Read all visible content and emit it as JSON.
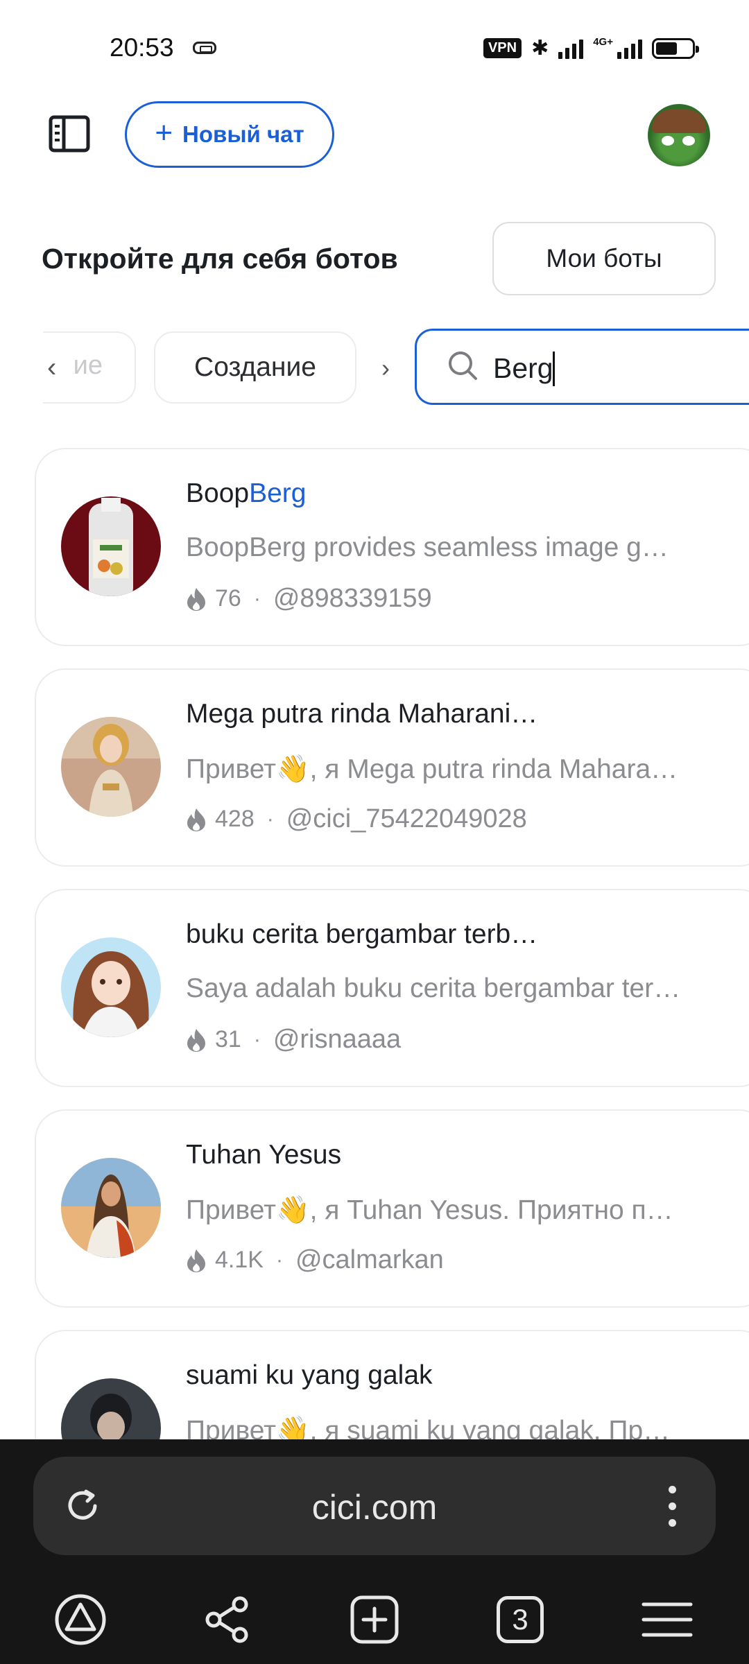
{
  "status_bar": {
    "time": "20:53",
    "vpn": "VPN",
    "network": "4G+",
    "battery_level": 0.6
  },
  "header": {
    "new_chat_label": "Новый чат",
    "section_title": "Откройте для себя ботов",
    "my_bots_label": "Мои боты"
  },
  "filters": {
    "prev_chip_partial": "ие",
    "chip_label": "Создание",
    "search_value": "Berg"
  },
  "bots": [
    {
      "name_prefix": "Boop",
      "name_highlight": "Berg",
      "description": "BoopBerg provides seamless image g…",
      "count": "76",
      "handle": "@898339159"
    },
    {
      "name": "Mega putra rinda Maharani…",
      "description": "Привет👋, я Mega putra rinda Mahara…",
      "count": "428",
      "handle": "@cici_75422049028"
    },
    {
      "name": "buku cerita bergambar terb…",
      "description": "Saya adalah buku cerita bergambar ter…",
      "count": "31",
      "handle": "@risnaaaa"
    },
    {
      "name": "Tuhan Yesus",
      "description": "Привет👋, я Tuhan Yesus. Приятно п…",
      "count": "4.1K",
      "handle": "@calmarkan"
    },
    {
      "name": "suami ku yang galak",
      "description": "Привет👋, я suami ku yang galak. Пр…",
      "count": "",
      "handle": ""
    }
  ],
  "browser": {
    "url": "cici.com",
    "tab_count": "3"
  },
  "colors": {
    "accent": "#1a5fd6",
    "browser_bg": "#161616",
    "urlbar_bg": "#2e2e2e"
  }
}
